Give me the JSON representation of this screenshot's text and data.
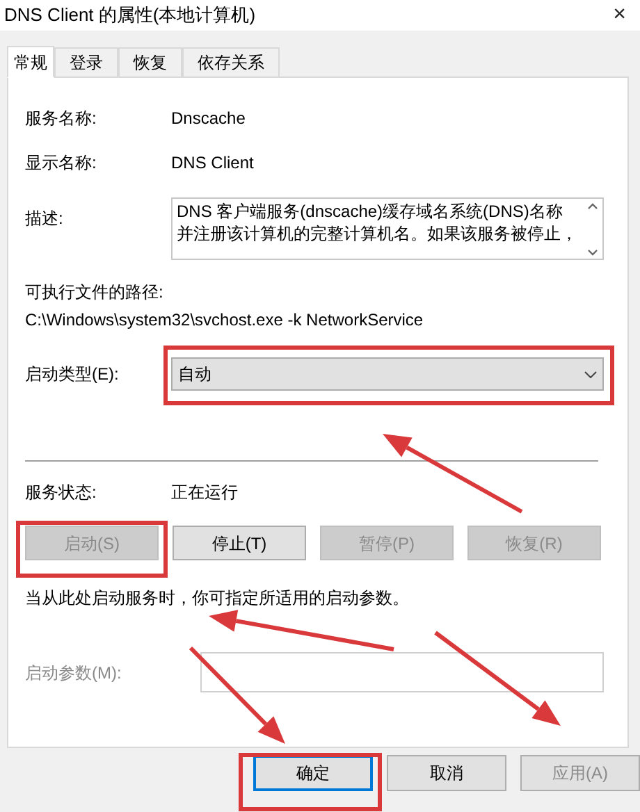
{
  "window": {
    "title": "DNS Client 的属性(本地计算机)",
    "close": "×"
  },
  "tabs": [
    {
      "label": "常规",
      "selected": true
    },
    {
      "label": "登录",
      "selected": false
    },
    {
      "label": "恢复",
      "selected": false
    },
    {
      "label": "依存关系",
      "selected": false
    }
  ],
  "service_name": {
    "label": "服务名称:",
    "value": "Dnscache"
  },
  "display_name": {
    "label": "显示名称:",
    "value": "DNS Client"
  },
  "description": {
    "label": "描述:",
    "lines": [
      "DNS 客户端服务(dnscache)缓存域名系统(DNS)名称",
      "并注册该计算机的完整计算机名。如果该服务被停止，"
    ]
  },
  "executable_path": {
    "label": "可执行文件的路径:",
    "value": "C:\\Windows\\system32\\svchost.exe -k NetworkService"
  },
  "startup_type": {
    "label": "启动类型(E):",
    "value": "自动"
  },
  "service_status": {
    "label": "服务状态:",
    "value": "正在运行"
  },
  "service_buttons": [
    {
      "label": "启动(S)",
      "disabled": true
    },
    {
      "label": "停止(T)",
      "disabled": false
    },
    {
      "label": "暂停(P)",
      "disabled": true
    },
    {
      "label": "恢复(R)",
      "disabled": true
    }
  ],
  "hint": "当从此处启动服务时，你可指定所适用的启动参数。",
  "start_parameters": {
    "label": "启动参数(M):",
    "disabled": true
  },
  "dialog_buttons": [
    {
      "label": "确定",
      "default": true,
      "disabled": false
    },
    {
      "label": "取消",
      "default": false,
      "disabled": false
    },
    {
      "label": "应用(A)",
      "default": false,
      "disabled": true
    }
  ]
}
